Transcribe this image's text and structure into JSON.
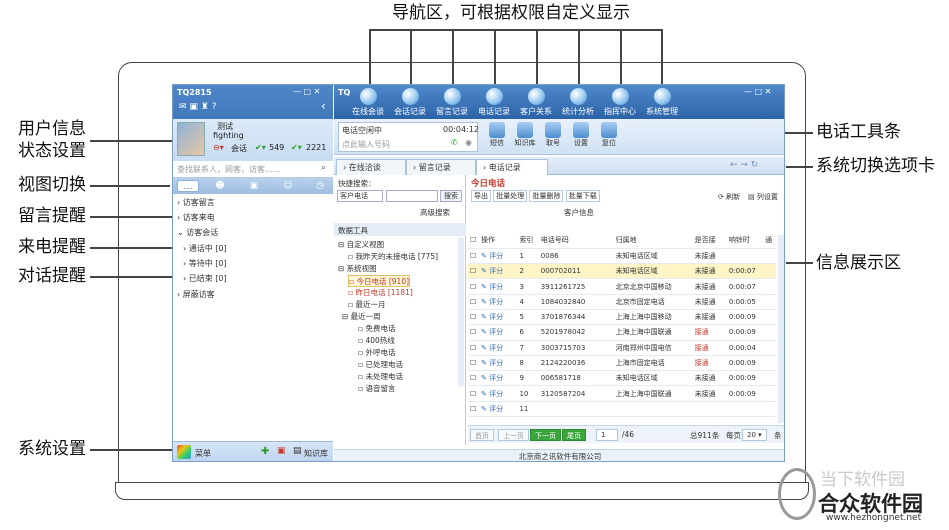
{
  "top_callout": "导航区，可根据权限自定义显示",
  "callouts_left": {
    "user_info": "用户信息",
    "status_settings": "状态设置",
    "view_switch": "视图切换",
    "message_remind": "留言提醒",
    "call_remind": "来电提醒",
    "chat_remind": "对话提醒",
    "system_settings": "系统设置"
  },
  "callouts_right": {
    "phone_toolbar": "电话工具条",
    "system_tabs": "系统切换选项卡",
    "info_area": "信息展示区"
  },
  "left_panel": {
    "app_title": "TQ2815",
    "username": "测试",
    "nickname": "fighting",
    "status": "会话",
    "count1": "549",
    "count2": "2221",
    "search_placeholder": "查找联系人，网客，访客......",
    "tree": [
      "访客留言",
      "访客来电",
      "访客会话",
      "通话中 [0]",
      "等待中 [0]",
      "已结束 [0]",
      "屏蔽访客"
    ],
    "menu_label": "菜单",
    "kb_label": "知识库"
  },
  "nav": {
    "logo": "TQ",
    "items": [
      "在线会谈",
      "会话记录",
      "留言记录",
      "电话记录",
      "客户关系",
      "统计分析",
      "指挥中心",
      "系统管理"
    ]
  },
  "toolbar": {
    "status": "电话空闲中",
    "timer": "00:04:12",
    "dial_placeholder": "点此输入号码",
    "buttons": [
      "短信",
      "知识库",
      "取号",
      "设置",
      "复位"
    ]
  },
  "tabs": [
    "在线洽谈",
    "留言记录",
    "电话记录"
  ],
  "mid": {
    "quick_search": "快捷搜索：",
    "select_value": "客户电话",
    "search_btn": "搜索",
    "advanced": "高级搜索",
    "data_tools": "数据工具",
    "items": [
      "自定义视图",
      "我昨天的未接电话 [775]",
      "系统视图",
      "今日电话 [910]",
      "昨日电话 [1181]",
      "最近一月",
      "最近一周",
      "免费电话",
      "400热线",
      "外呼电话",
      "已处理电话",
      "未处理电话",
      "语音留言"
    ]
  },
  "grid": {
    "title": "今日电话",
    "actions": [
      "导出",
      "批量处理",
      "批量删除",
      "批量下载"
    ],
    "refresh": "刷新",
    "columns_btn": "列设置",
    "group_header": "客户信息",
    "headers": [
      "操作",
      "索引",
      "电话号码",
      "归属地",
      "是否接",
      "响铃时",
      "通"
    ],
    "edit_label": "评分",
    "rows": [
      {
        "idx": "1",
        "phone": "0086",
        "loc": "未知电话区域",
        "ans": "未接通",
        "ring": ""
      },
      {
        "idx": "2",
        "phone": "000702011",
        "loc": "未知电话区域",
        "ans": "未接通",
        "ring": "0:00:07"
      },
      {
        "idx": "3",
        "phone": "3911261725",
        "loc": "北京北京中国移动",
        "ans": "未接通",
        "ring": "0:00:07"
      },
      {
        "idx": "4",
        "phone": "1084032840",
        "loc": "北京市固定电话",
        "ans": "未接通",
        "ring": "0:00:05"
      },
      {
        "idx": "5",
        "phone": "3701876344",
        "loc": "上海上海中国移动",
        "ans": "未接通",
        "ring": "0:00:09"
      },
      {
        "idx": "6",
        "phone": "5201978042",
        "loc": "上海上海中国联通",
        "ans": "接通",
        "ring": "0:00:09"
      },
      {
        "idx": "7",
        "phone": "3003715703",
        "loc": "河南郑州中国电信",
        "ans": "接通",
        "ring": "0:00:04"
      },
      {
        "idx": "8",
        "phone": "2124220036",
        "loc": "上海市固定电话",
        "ans": "接通",
        "ring": "0:00:09"
      },
      {
        "idx": "9",
        "phone": "006581718",
        "loc": "未知电话区域",
        "ans": "未接通",
        "ring": "0:00:09"
      },
      {
        "idx": "10",
        "phone": "3120587204",
        "loc": "上海上海中国联通",
        "ans": "未接通",
        "ring": "0:00:09"
      },
      {
        "idx": "11",
        "phone": "",
        "loc": "",
        "ans": "",
        "ring": ""
      }
    ]
  },
  "pager": {
    "first": "首页",
    "prev": "上一页",
    "next": "下一页",
    "last": "尾页",
    "page": "1",
    "total_pages": "/46",
    "total": "总911条",
    "per_label": "每页",
    "per_value": "20",
    "per_suffix": "条"
  },
  "statusbar": "北京商之讯软件有限公司",
  "watermark": {
    "line1": "当下软件园",
    "line2": "合众软件园",
    "url": "www.hezhongnet.net"
  },
  "colors": {
    "nav_blue": "#2f67ad",
    "accent_red": "#c0392b",
    "green": "#2e9a2e",
    "highlight": "#fff4c6"
  }
}
